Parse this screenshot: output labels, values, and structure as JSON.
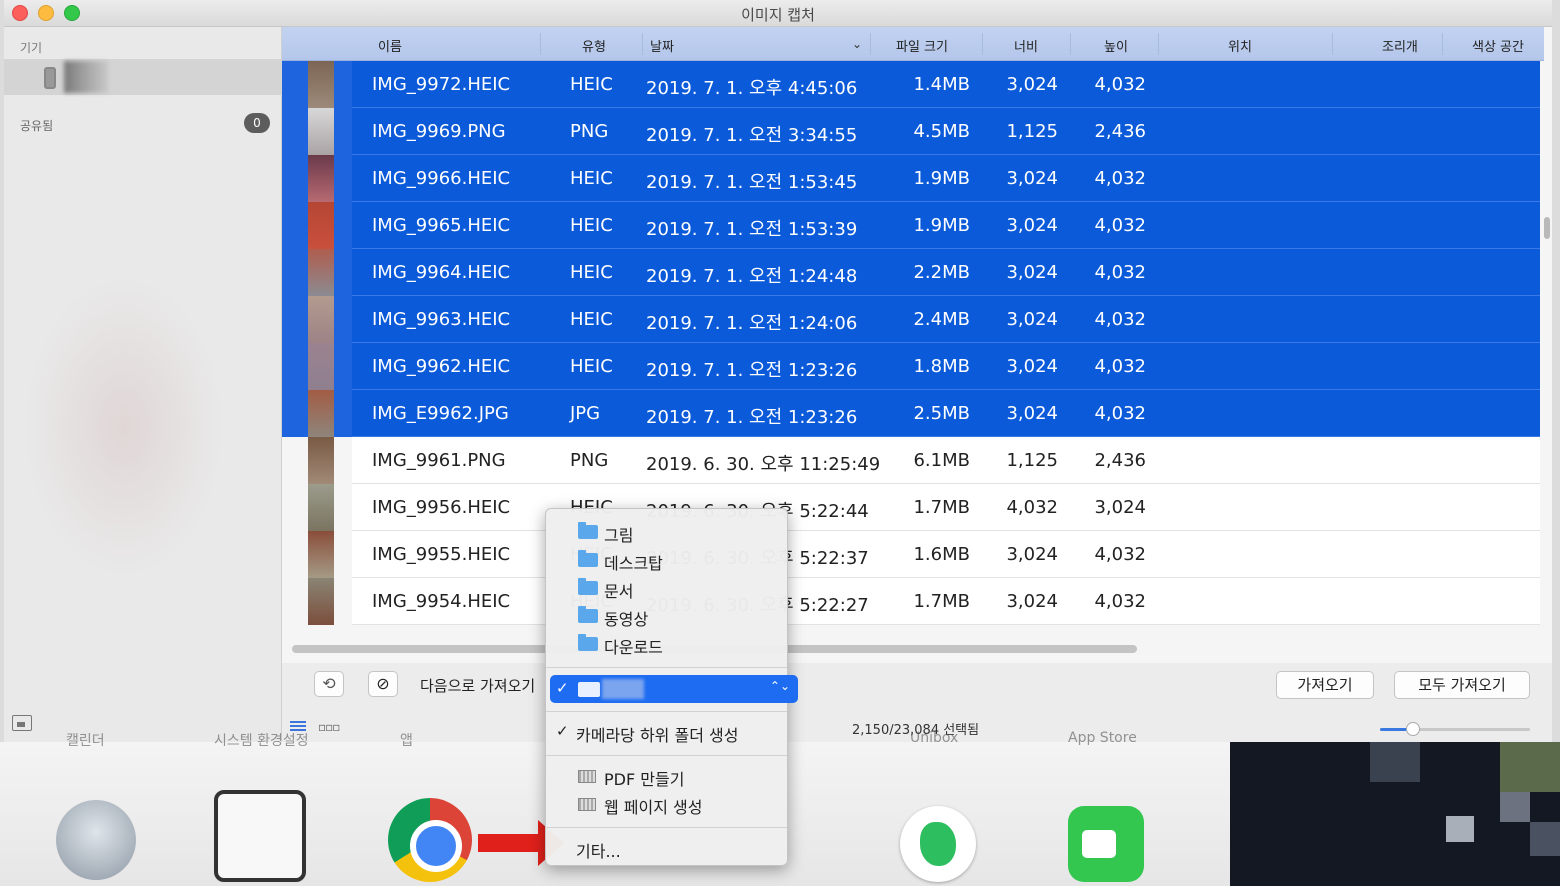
{
  "window": {
    "title": "이미지 캡처"
  },
  "sidebar": {
    "devices_header": "기기",
    "shared_label": "공유됨",
    "shared_count": "0"
  },
  "table": {
    "columns": [
      "이름",
      "유형",
      "날짜",
      "파일 크기",
      "너비",
      "높이",
      "위치",
      "조리개",
      "색상 공간"
    ],
    "rows": [
      {
        "name": "IMG_9972.HEIC",
        "type": "HEIC",
        "date": "2019. 7. 1. 오후 4:45:06",
        "size": "1.4MB",
        "width": "3,024",
        "height": "4,032",
        "selected": true
      },
      {
        "name": "IMG_9969.PNG",
        "type": "PNG",
        "date": "2019. 7. 1. 오전 3:34:55",
        "size": "4.5MB",
        "width": "1,125",
        "height": "2,436",
        "selected": true
      },
      {
        "name": "IMG_9966.HEIC",
        "type": "HEIC",
        "date": "2019. 7. 1. 오전 1:53:45",
        "size": "1.9MB",
        "width": "3,024",
        "height": "4,032",
        "selected": true
      },
      {
        "name": "IMG_9965.HEIC",
        "type": "HEIC",
        "date": "2019. 7. 1. 오전 1:53:39",
        "size": "1.9MB",
        "width": "3,024",
        "height": "4,032",
        "selected": true
      },
      {
        "name": "IMG_9964.HEIC",
        "type": "HEIC",
        "date": "2019. 7. 1. 오전 1:24:48",
        "size": "2.2MB",
        "width": "3,024",
        "height": "4,032",
        "selected": true
      },
      {
        "name": "IMG_9963.HEIC",
        "type": "HEIC",
        "date": "2019. 7. 1. 오전 1:24:06",
        "size": "2.4MB",
        "width": "3,024",
        "height": "4,032",
        "selected": true
      },
      {
        "name": "IMG_9962.HEIC",
        "type": "HEIC",
        "date": "2019. 7. 1. 오전 1:23:26",
        "size": "1.8MB",
        "width": "3,024",
        "height": "4,032",
        "selected": true
      },
      {
        "name": "IMG_E9962.JPG",
        "type": "JPG",
        "date": "2019. 7. 1. 오전 1:23:26",
        "size": "2.5MB",
        "width": "3,024",
        "height": "4,032",
        "selected": true
      },
      {
        "name": "IMG_9961.PNG",
        "type": "PNG",
        "date": "2019. 6. 30. 오후 11:25:49",
        "size": "6.1MB",
        "width": "1,125",
        "height": "2,436",
        "selected": false
      },
      {
        "name": "IMG_9956.HEIC",
        "type": "HEIC",
        "date": "2019. 6. 30. 오후 5:22:44",
        "size": "1.7MB",
        "width": "4,032",
        "height": "3,024",
        "selected": false
      },
      {
        "name": "IMG_9955.HEIC",
        "type": "HEIC",
        "date": "2019. 6. 30. 오후 5:22:37",
        "size": "1.6MB",
        "width": "3,024",
        "height": "4,032",
        "selected": false
      },
      {
        "name": "IMG_9954.HEIC",
        "type": "HEIC",
        "date": "2019. 6. 30. 오후 5:22:27",
        "size": "1.7MB",
        "width": "3,024",
        "height": "4,032",
        "selected": false
      }
    ]
  },
  "footer": {
    "import_to_label": "다음으로 가져오기",
    "import_button": "가져오기",
    "import_all_button": "모두 가져오기",
    "selection_count": "2,150/23,084 선택됨"
  },
  "popup": {
    "folders": [
      "그림",
      "데스크탑",
      "문서",
      "동영상",
      "다운로드"
    ],
    "option_subfolder": "카메라당 하위 폴더 생성",
    "app_items": [
      "PDF 만들기",
      "웹 페이지 생성"
    ],
    "other": "기타..."
  },
  "dock": {
    "labels": [
      "캘린더",
      "시스템 환경설정",
      "앱",
      "Unibox",
      "App Store"
    ]
  },
  "colors": {
    "selection": "#0a5ad9",
    "accent": "#1e6cf2"
  }
}
